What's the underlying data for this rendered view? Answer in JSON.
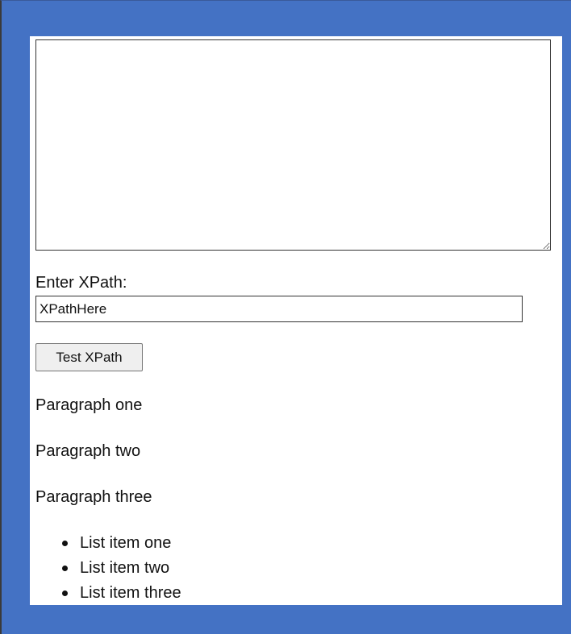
{
  "xml_editor": {
    "value": ""
  },
  "xpath": {
    "label": "Enter XPath:",
    "value": "XPathHere"
  },
  "test_button": {
    "label": "Test XPath"
  },
  "paragraphs": [
    "Paragraph one",
    "Paragraph two",
    "Paragraph three"
  ],
  "list_items": [
    "List item one",
    "List item two",
    "List item three"
  ],
  "colors": {
    "frame_background": "#4472c4",
    "panel_background": "#ffffff",
    "button_background": "#efefef"
  },
  "icons": {
    "textarea_resize_handle": "resize-grip-icon",
    "list_bullet": "bullet-icon"
  }
}
